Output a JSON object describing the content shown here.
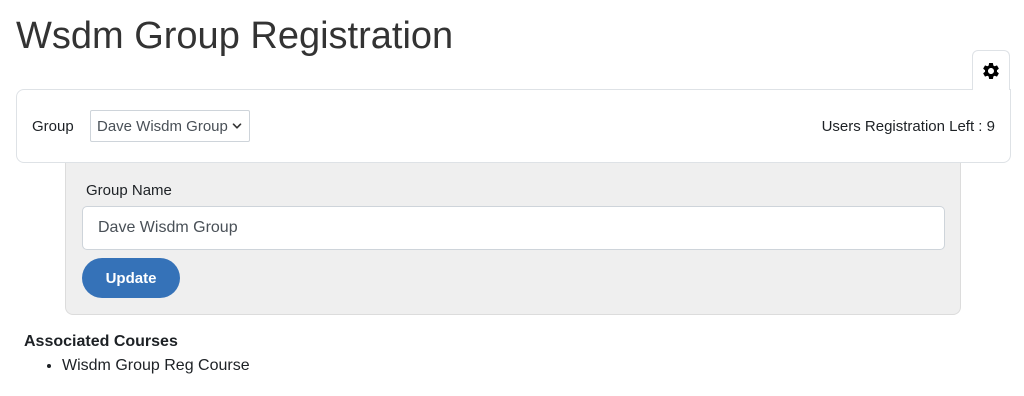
{
  "page": {
    "title": "Wsdm Group Registration"
  },
  "settings": {
    "icon": "gear-icon"
  },
  "group_selector": {
    "label": "Group",
    "selected": "Dave Wisdm Group",
    "users_left": "Users Registration Left : 9"
  },
  "edit_form": {
    "name_label": "Group Name",
    "name_value": "Dave Wisdm Group",
    "update_label": "Update"
  },
  "courses": {
    "heading": "Associated Courses",
    "items": [
      "Wisdm Group Reg Course"
    ]
  },
  "colors": {
    "primary_button": "#3572b8",
    "panel_background": "#efefef"
  }
}
